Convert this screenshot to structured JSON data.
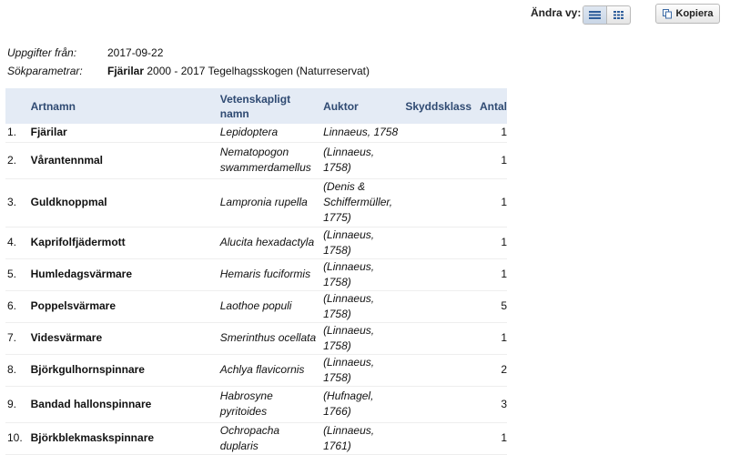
{
  "toolbar": {
    "view_label": "Ändra vy:",
    "view_options": [
      "list-view-icon",
      "grid-view-icon"
    ],
    "active_view": "list-view-icon",
    "copy_label": "Kopiera"
  },
  "meta": {
    "source_label": "Uppgifter från:",
    "source_date": "2017-09-22",
    "search_label": "Sökparametrar:",
    "search_group": "Fjärilar",
    "search_rest": "2000 - 2017 Tegelhagsskogen (Naturreservat)"
  },
  "table": {
    "headers": {
      "name": "Artnamn",
      "scientific": "Vetenskapligt namn",
      "author": "Auktor",
      "protection": "Skyddsklass",
      "count": "Antal"
    },
    "rows": [
      {
        "index": "1.",
        "name": "Fjärilar",
        "scientific": "Lepidoptera",
        "author": "Linnaeus, 1758",
        "protection": "",
        "count": "1"
      },
      {
        "index": "2.",
        "name": "Vårantennmal",
        "scientific": "Nematopogon swammerdamellus",
        "author": "(Linnaeus, 1758)",
        "protection": "",
        "count": "1"
      },
      {
        "index": "3.",
        "name": "Guldknoppmal",
        "scientific": "Lampronia rupella",
        "author": "(Denis & Schiffermüller, 1775)",
        "protection": "",
        "count": "1"
      },
      {
        "index": "4.",
        "name": "Kaprifolfjädermott",
        "scientific": "Alucita hexadactyla",
        "author": "(Linnaeus, 1758)",
        "protection": "",
        "count": "1"
      },
      {
        "index": "5.",
        "name": "Humledagsvärmare",
        "scientific": "Hemaris fuciformis",
        "author": "(Linnaeus, 1758)",
        "protection": "",
        "count": "1"
      },
      {
        "index": "6.",
        "name": "Poppelsvärmare",
        "scientific": "Laothoe populi",
        "author": "(Linnaeus, 1758)",
        "protection": "",
        "count": "5"
      },
      {
        "index": "7.",
        "name": "Videsvärmare",
        "scientific": "Smerinthus ocellata",
        "author": "(Linnaeus, 1758)",
        "protection": "",
        "count": "1"
      },
      {
        "index": "8.",
        "name": "Björkgulhornspinnare",
        "scientific": "Achlya flavicornis",
        "author": "(Linnaeus, 1758)",
        "protection": "",
        "count": "2"
      },
      {
        "index": "9.",
        "name": "Bandad hallonspinnare",
        "scientific": "Habrosyne pyritoides",
        "author": "(Hufnagel, 1766)",
        "protection": "",
        "count": "3"
      },
      {
        "index": "10.",
        "name": "Björkblekmaskspinnare",
        "scientific": "Ochropacha duplaris",
        "author": "(Linnaeus, 1761)",
        "protection": "",
        "count": "1"
      }
    ]
  }
}
